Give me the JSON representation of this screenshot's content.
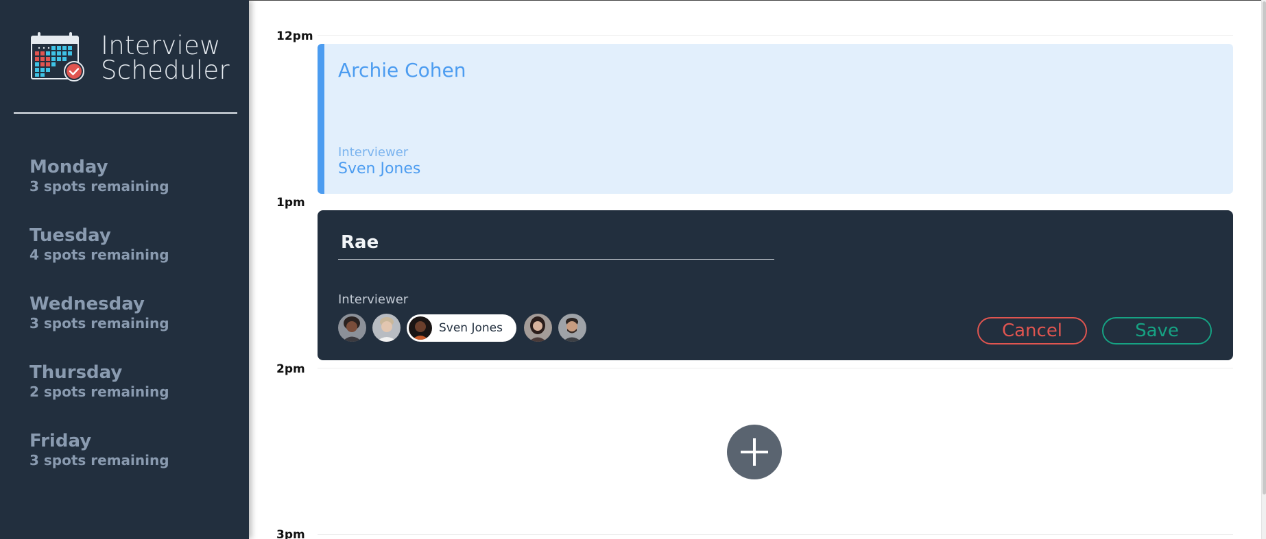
{
  "app": {
    "title_line1": "Interview",
    "title_line2": "Scheduler"
  },
  "sidebar": {
    "days": [
      {
        "name": "Monday",
        "spots": "3 spots remaining"
      },
      {
        "name": "Tuesday",
        "spots": "4 spots remaining"
      },
      {
        "name": "Wednesday",
        "spots": "3 spots remaining"
      },
      {
        "name": "Thursday",
        "spots": "2 spots remaining"
      },
      {
        "name": "Friday",
        "spots": "3 spots remaining"
      }
    ]
  },
  "schedule": {
    "times": [
      "12pm",
      "1pm",
      "2pm",
      "3pm"
    ],
    "booked": {
      "student": "Archie Cohen",
      "interviewer_label": "Interviewer",
      "interviewer": "Sven Jones"
    },
    "form": {
      "student_name_value": "Rae",
      "interviewer_label": "Interviewer",
      "selected_interviewer": "Sven Jones",
      "cancel_label": "Cancel",
      "save_label": "Save"
    }
  },
  "icons": {
    "logo": "calendar-check-icon",
    "add": "plus-icon"
  },
  "colors": {
    "sidebar_bg": "#222f3e",
    "accent_blue": "#4c9cf0",
    "card_blue_bg": "#e2effc",
    "danger": "#e05550",
    "success": "#16a283",
    "add_button": "#5a6470"
  }
}
